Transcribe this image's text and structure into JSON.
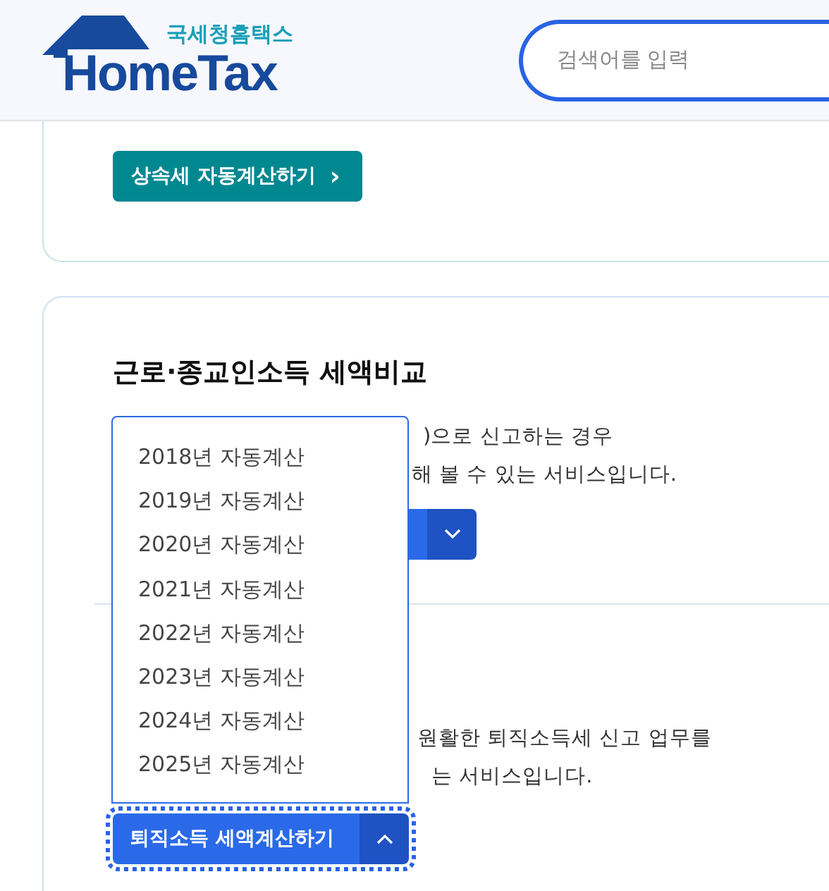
{
  "header": {
    "logo_subtitle": "국세청홈택스",
    "logo_title": "HomeTax",
    "search": {
      "placeholder": "검색어를 입력"
    }
  },
  "sections": [
    {
      "kind": "top",
      "button": "상속세 자동계산하기",
      "button_icon": "›"
    },
    {
      "kind": "compare",
      "title": "근로·종교인소득 세액비교",
      "lines": [
        ")으로 신고하는 경우",
        "해 볼 수 있는 서비스입니다."
      ]
    },
    {
      "kind": "retire",
      "lines": [
        "원활한 퇴직소득세 신고 업무를",
        "는 서비스입니다."
      ],
      "button": "퇴직소득 세액계산하기",
      "expanded": true
    }
  ],
  "dropdown": {
    "items": [
      {
        "label": "2018년 자동계산",
        "selected": false
      },
      {
        "label": "2019년 자동계산",
        "selected": false
      },
      {
        "label": "2020년 자동계산",
        "selected": false
      },
      {
        "label": "2021년 자동계산",
        "selected": false
      },
      {
        "label": "2022년 자동계산",
        "selected": false
      },
      {
        "label": "2023년 자동계산",
        "selected": false
      },
      {
        "label": "2024년 자동계산",
        "selected": false
      },
      {
        "label": "2025년 자동계산",
        "selected": false
      }
    ]
  }
}
